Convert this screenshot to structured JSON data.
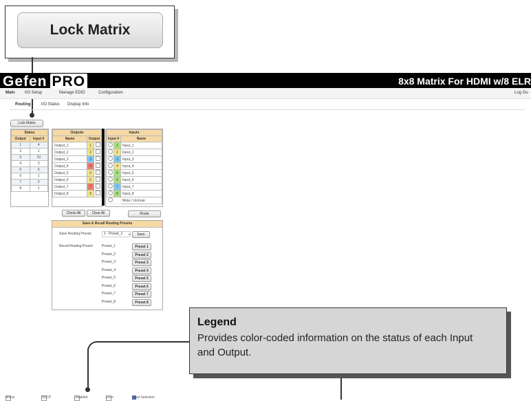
{
  "callout_top": {
    "button_label": "Lock Matrix"
  },
  "header": {
    "brand": "Gefen",
    "brand_pro": "PRO",
    "title": "8x8 Matrix For HDMI w/8 ELR"
  },
  "menu": {
    "items": [
      "Main",
      "I/O Setup",
      "Manage EDID",
      "Configuration"
    ],
    "logout": "Log Ou"
  },
  "subtabs": [
    "Routing",
    "I/O Status",
    "Display Info"
  ],
  "lock_button_small": "Lock Matrix",
  "status_table": {
    "title": "Status",
    "columns": [
      "Output",
      "Input #"
    ],
    "rows": [
      [
        "1",
        "4"
      ],
      [
        "2",
        "1"
      ],
      [
        "3",
        "10"
      ],
      [
        "4",
        "3"
      ],
      [
        "5",
        "6"
      ],
      [
        "6",
        "1"
      ],
      [
        "7",
        "2"
      ],
      [
        "8",
        "1"
      ]
    ]
  },
  "outputs_table": {
    "title": "Outputs",
    "columns": [
      "Name",
      "Output"
    ],
    "rows": [
      {
        "name": "Output_1",
        "num": "1",
        "color": "#f1e58a"
      },
      {
        "name": "Output_2",
        "num": "2",
        "color": "#f1e58a"
      },
      {
        "name": "Output_3",
        "num": "3",
        "color": "#7fc6ef"
      },
      {
        "name": "Output_4",
        "num": "4",
        "color": "#ef7a6c"
      },
      {
        "name": "Output_5",
        "num": "5",
        "color": "#f1e58a"
      },
      {
        "name": "Output_6",
        "num": "6",
        "color": "#f1e58a"
      },
      {
        "name": "Output_7",
        "num": "7",
        "color": "#ef7a6c"
      },
      {
        "name": "Output_8",
        "num": "8",
        "color": "#f1e58a"
      }
    ],
    "check_all": "Check All",
    "clear_all": "Clear All"
  },
  "inputs_table": {
    "title": "Inputs",
    "columns": [
      "Input #",
      "Name"
    ],
    "rows": [
      {
        "num": "1",
        "name": "Input_1",
        "color": "#a9e07d"
      },
      {
        "num": "2",
        "name": "Input_2",
        "color": "#f1e58a"
      },
      {
        "num": "3",
        "name": "Input_3",
        "color": "#7fc6ef"
      },
      {
        "num": "4",
        "name": "Input_4",
        "color": "#f1e58a"
      },
      {
        "num": "5",
        "name": "Input_5",
        "color": "#a9e07d"
      },
      {
        "num": "6",
        "name": "Input_6",
        "color": "#a9e07d"
      },
      {
        "num": "7",
        "name": "Input_7",
        "color": "#7fc6ef"
      },
      {
        "num": "8",
        "name": "Input_8",
        "color": "#a9e07d"
      }
    ],
    "mute_label": "Mute / Unmute",
    "route_button": "Route"
  },
  "presets": {
    "title": "Save & Recall Routing Presets",
    "save_label": "Save Routing Preset:",
    "save_select": "1 - Preset_1",
    "save_button": "Save",
    "recall_label": "Recall Routing Preset:",
    "items": [
      {
        "name": "Preset_1",
        "button": "Preset 1"
      },
      {
        "name": "Preset_2",
        "button": "Preset 2"
      },
      {
        "name": "Preset_3",
        "button": "Preset 3"
      },
      {
        "name": "Preset_4",
        "button": "Preset 4"
      },
      {
        "name": "Preset_5",
        "button": "Preset 5"
      },
      {
        "name": "Preset_6",
        "button": "Preset 6"
      },
      {
        "name": "Preset_7",
        "button": "Preset 7"
      },
      {
        "name": "Preset_8",
        "button": "Preset 8"
      }
    ]
  },
  "legend": {
    "title": "Legend",
    "description": "Provides color-coded information on the status of each Input and Output."
  },
  "status_legend": [
    "Active",
    "HDCP",
    "Disabled",
    "Error",
    "Input Selection"
  ]
}
